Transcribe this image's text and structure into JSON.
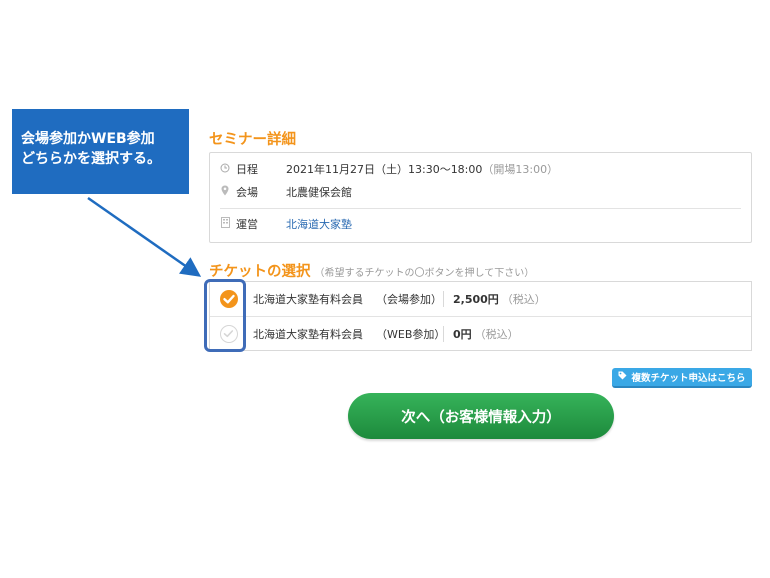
{
  "callout": {
    "line1": "会場参加かWEB参加",
    "line2": "どちらかを選択する。"
  },
  "seminar": {
    "title": "セミナー詳細",
    "date_label": "日程",
    "date_value": "2021年11月27日（土）13:30〜18:00",
    "date_note": "（開場13:00）",
    "venue_label": "会場",
    "venue_value": "北農健保会館",
    "organizer_label": "運営",
    "organizer_value": "北海道大家塾"
  },
  "tickets": {
    "title": "チケットの選択",
    "note": "（希望するチケットの〇ボタンを押して下さい）",
    "items": [
      {
        "name": "北海道大家塾有料会員",
        "type": "（会場参加）",
        "price": "2,500円",
        "tax": "（税込）",
        "selected": true
      },
      {
        "name": "北海道大家塾有料会員",
        "type": "（WEB参加）",
        "price": "0円",
        "tax": "（税込）",
        "selected": false
      }
    ]
  },
  "multi_ticket_button": "複数チケット申込はこちら",
  "next_button": "次へ（お客様情報入力）",
  "colors": {
    "accent": "#f3941b",
    "callout": "#1f6cc0",
    "next": "#1d8a3c",
    "link": "#2a6ab2"
  }
}
